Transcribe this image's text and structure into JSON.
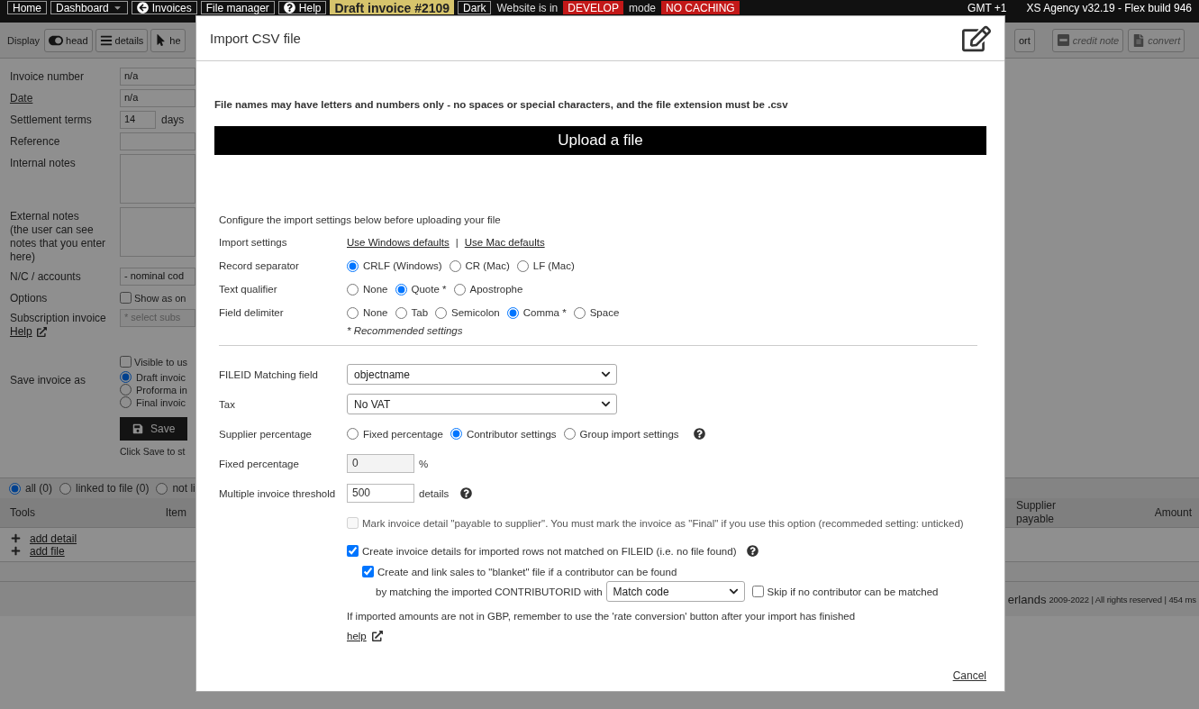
{
  "top_bar": {
    "items": [
      {
        "kind": "button",
        "label": "Home"
      },
      {
        "kind": "menu",
        "label": "Dashboard"
      },
      {
        "kind": "back",
        "label": "Invoices"
      },
      {
        "kind": "button",
        "label": "File manager"
      },
      {
        "kind": "help",
        "label": "Help"
      },
      {
        "kind": "title",
        "label": "Draft invoice #2109"
      },
      {
        "kind": "button",
        "label": "Dark"
      },
      {
        "kind": "text",
        "label": "Website is in"
      },
      {
        "kind": "alert",
        "label": "DEVELOP"
      },
      {
        "kind": "text",
        "label": "mode"
      },
      {
        "kind": "alert",
        "label": "NO CACHING"
      }
    ],
    "right": [
      "GMT +1",
      "XS Agency v32.19 - Flex build 946"
    ]
  },
  "toolbar": {
    "label": "Display",
    "left": [
      {
        "kind": "toggle",
        "label": "head"
      },
      {
        "kind": "list",
        "label": "details"
      },
      {
        "kind": "pointer",
        "label": "he"
      }
    ],
    "right": [
      {
        "kind": "plain",
        "label": "ort",
        "disabled": false
      },
      {
        "kind": "minus",
        "label": "credit note",
        "disabled": true
      },
      {
        "kind": "doc",
        "label": "convert",
        "disabled": true
      }
    ]
  },
  "invoice_form": {
    "fields": [
      {
        "kind": "input",
        "label": "Invoice number",
        "value": "n/a"
      },
      {
        "kind": "input",
        "label": "Date",
        "label_link": true,
        "value": "n/a"
      },
      {
        "kind": "short-input",
        "label": "Settlement terms",
        "value": "14",
        "unit": "days"
      },
      {
        "kind": "input",
        "label": "Reference"
      },
      {
        "kind": "textarea",
        "label": "Internal notes"
      },
      {
        "kind": "textarea",
        "label": "External notes",
        "sublabel": "(the user can see notes that you enter here)"
      },
      {
        "kind": "select",
        "label": "N/C / accounts",
        "value": "- nominal cod"
      },
      {
        "kind": "checkbox",
        "label": "Options",
        "text": "Show as on",
        "checked": false
      },
      {
        "kind": "select",
        "label": "Subscription invoice",
        "help_link": "Help",
        "placeholder": "* select subs"
      },
      {
        "kind": "checkbox",
        "text": "Visible to us",
        "checked": false
      },
      {
        "kind": "radios",
        "label": "Save invoice as",
        "options": [
          {
            "label": "Draft invoic",
            "selected": true
          },
          {
            "label": "Proforma in",
            "selected": false
          },
          {
            "label": "Final invoic",
            "selected": false
          }
        ]
      },
      {
        "kind": "save",
        "button": "Save",
        "hint": "Click Save to st"
      }
    ]
  },
  "details_table": {
    "filters": [
      {
        "label": "all (0)",
        "selected": true
      },
      {
        "label": "linked to file (0)",
        "selected": false
      },
      {
        "label": "not li",
        "selected": false
      }
    ],
    "columns_left": [
      "Tools",
      "Item"
    ],
    "columns_right": [
      "Supplier payable",
      "Amount"
    ],
    "actions": [
      "add detail",
      "add file"
    ]
  },
  "footer": {
    "name_fragment": "erlands",
    "text": "2009-2022 | All rights reserved | 454 ms"
  },
  "modal": {
    "title": "Import CSV file",
    "note": "File names may have letters and numbers only - no spaces or special characters, and the file extension must be .csv",
    "upload_button": "Upload a file",
    "intro": "Configure the import settings below before uploading your file",
    "settings": [
      {
        "kind": "links",
        "label": "Import settings",
        "links": [
          "Use Windows defaults",
          "Use Mac defaults"
        ],
        "separator": "|"
      },
      {
        "kind": "radios",
        "label": "Record separator",
        "options": [
          {
            "label": "CRLF (Windows)",
            "selected": true
          },
          {
            "label": "CR (Mac)",
            "selected": false
          },
          {
            "label": "LF (Mac)",
            "selected": false
          }
        ]
      },
      {
        "kind": "radios",
        "label": "Text qualifier",
        "options": [
          {
            "label": "None",
            "selected": false
          },
          {
            "label": "Quote *",
            "selected": true
          },
          {
            "label": "Apostrophe",
            "selected": false
          }
        ]
      },
      {
        "kind": "radios",
        "label": "Field delimiter",
        "options": [
          {
            "label": "None",
            "selected": false
          },
          {
            "label": "Tab",
            "selected": false
          },
          {
            "label": "Semicolon",
            "selected": false
          },
          {
            "label": "Comma *",
            "selected": true
          },
          {
            "label": "Space",
            "selected": false
          }
        ]
      }
    ],
    "recommended_note": "* Recommended settings",
    "options": [
      {
        "kind": "select",
        "label": "FILEID Matching field",
        "value": "objectname"
      },
      {
        "kind": "select",
        "label": "Tax",
        "value": "No VAT"
      },
      {
        "kind": "radios",
        "label": "Supplier percentage",
        "help": true,
        "options": [
          {
            "label": "Fixed percentage",
            "selected": false
          },
          {
            "label": "Contributor settings",
            "selected": true
          },
          {
            "label": "Group import settings",
            "selected": false
          }
        ]
      },
      {
        "kind": "input",
        "label": "Fixed percentage",
        "value": "0",
        "unit": "%",
        "disabled": true
      },
      {
        "kind": "input",
        "label": "Multiple invoice threshold",
        "value": "500",
        "unit": "details",
        "help": true,
        "disabled": false
      }
    ],
    "checkboxes": [
      {
        "text": "Mark invoice detail \"payable to supplier\". You must mark the invoice as \"Final\" if you use this option (recommeded setting: unticked)",
        "checked": false,
        "disabled": true
      },
      {
        "text": "Create invoice details for imported rows not matched on FILEID (i.e. no file found)",
        "checked": true,
        "disabled": false,
        "help": true,
        "children": [
          {
            "text": "Create and link sales to \"blanket\" file if a contributor can be found",
            "checked": true,
            "disabled": false
          }
        ]
      }
    ],
    "contributor_match": {
      "label": "by matching the imported CONTRIBUTORID with",
      "value": "Match code",
      "skip": {
        "text": "Skip if no contributor can be matched",
        "checked": false
      }
    },
    "currency_note": "If imported amounts are not in GBP, remember to use the 'rate conversion' button after your import has finished",
    "help_link": "help",
    "cancel": "Cancel"
  }
}
